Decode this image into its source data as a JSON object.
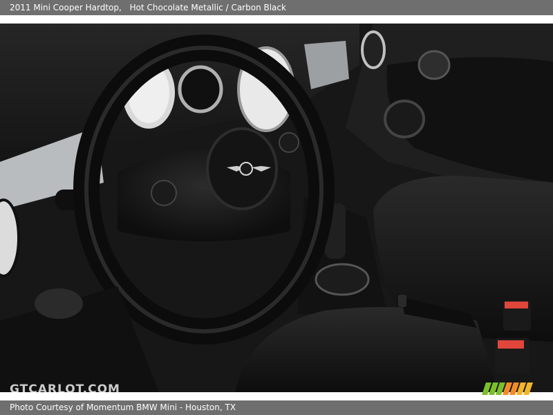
{
  "caption": {
    "title": "2011 Mini Cooper Hardtop,",
    "color_text": "Hot Chocolate Metallic / Carbon Black"
  },
  "photo": {
    "description_icon": "car-interior-photo"
  },
  "watermark": {
    "text": "GTCARLOT.COM"
  },
  "footer": {
    "credit": "Photo Courtesy of Momentum BMW Mini - Houston, TX"
  },
  "colors": {
    "bar": "#6f6f6f",
    "stripe_green": "#7bbf2a",
    "stripe_orange": "#f28c28"
  }
}
